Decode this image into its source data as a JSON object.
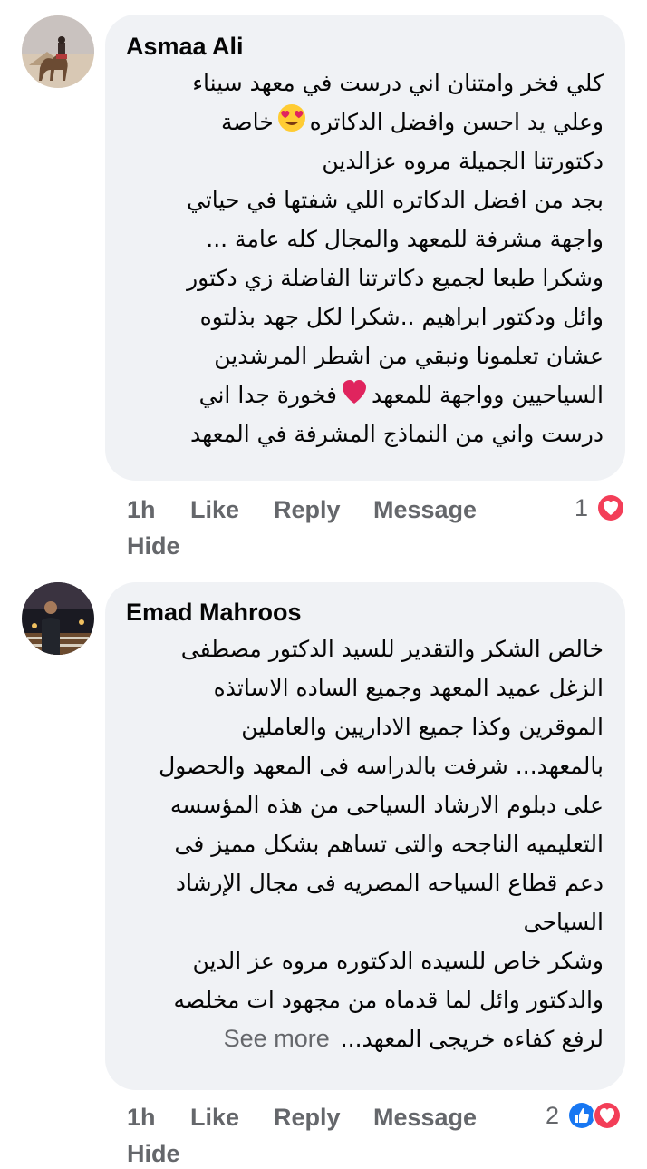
{
  "comments": [
    {
      "author": "Asmaa Ali",
      "lines": [
        "كلي فخر وامتنان اني درست في معهد سيناء",
        "وعلي يد احسن وافضل الدكاتره",
        "دكتورتنا الجميلة مروه عزالدين",
        "بجد من افضل الدكاتره اللي شفتها في حياتي",
        "واجهة مشرفة للمعهد والمجال كله عامة ...",
        "وشكرا طبعا لجميع دكاترتنا الفاضلة زي دكتور",
        "وائل ودكتور ابراهيم ..شكرا لكل جهد بذلتوه",
        "عشان تعلمونا ونبقي من اشطر المرشدين",
        "السياحيين وواجهة للمعهد",
        "درست واني من النماذج المشرفة في المعهد"
      ],
      "line2_tail": "خاصة",
      "line9_tail": "فخورة جدا اني",
      "time": "1h",
      "like": "Like",
      "reply": "Reply",
      "message": "Message",
      "hide": "Hide",
      "reaction_count": "1",
      "reaction_icons": [
        "love-icon"
      ]
    },
    {
      "author": "Emad Mahroos",
      "lines": [
        "خالص الشكر والتقدير للسيد الدكتور مصطفى",
        "الزغل عميد المعهد وجميع الساده الاساتذه",
        "الموقرين وكذا جميع الاداريين والعاملين",
        "بالمعهد... شرفت بالدراسه فى المعهد والحصول",
        "على دبلوم الارشاد السياحى من هذه المؤسسه",
        "التعليميه الناجحه والتى تساهم بشكل مميز فى",
        "دعم قطاع السياحه المصريه فى مجال الإرشاد",
        "السياحى",
        "وشكر خاص للسيده الدكتوره مروه عز الدين",
        "والدكتور وائل لما قدماه من مجهود ات مخلصه",
        "لرفع كفاءه خريجى المعهد..."
      ],
      "see_more": "See more",
      "time": "1h",
      "like": "Like",
      "reply": "Reply",
      "message": "Message",
      "hide": "Hide",
      "reaction_count": "2",
      "reaction_icons": [
        "like-icon",
        "love-icon"
      ]
    }
  ],
  "colors": {
    "bubble": "#f0f2f5",
    "meta": "#65676b",
    "text": "#050505",
    "love": "#f33e58",
    "like": "#1877f2"
  }
}
